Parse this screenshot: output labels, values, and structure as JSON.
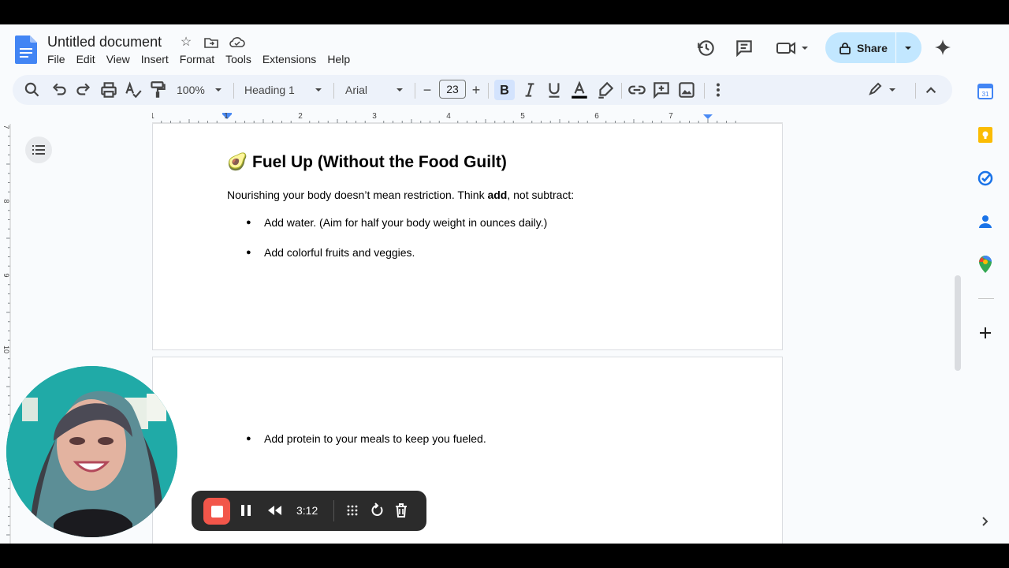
{
  "app": {
    "doc_title": "Untitled document",
    "menu": [
      "File",
      "Edit",
      "View",
      "Insert",
      "Format",
      "Tools",
      "Extensions",
      "Help"
    ],
    "share_label": "Share"
  },
  "toolbar": {
    "zoom": "100%",
    "style": "Heading 1",
    "font": "Arial",
    "font_size": "23",
    "minus": "−",
    "plus": "+"
  },
  "ruler": {
    "marks": [
      "1",
      "1",
      "2",
      "3",
      "4",
      "5",
      "6",
      "7"
    ],
    "vmarks": [
      "7",
      "8",
      "9",
      "10"
    ]
  },
  "document": {
    "heading_emoji": "🥑",
    "heading": "Fuel Up (Without the Food Guilt)",
    "intro_before": "Nourishing your body doesn’t mean restriction. Think ",
    "intro_bold": "add",
    "intro_after": ", not subtract:",
    "bullets_page1": [
      "Add water. (Aim for half your body weight in ounces daily.)",
      "Add colorful fruits and veggies."
    ],
    "bullets_page2": [
      "Add protein to your meals to keep you fueled."
    ],
    "bullet_glyph": "●"
  },
  "recorder": {
    "time": "3:12"
  },
  "colors": {
    "share_bg": "#c2e7ff",
    "toolbar_bg": "#edf2fa",
    "accent_blue": "#1a73e8",
    "rec_red": "#f2564a"
  }
}
